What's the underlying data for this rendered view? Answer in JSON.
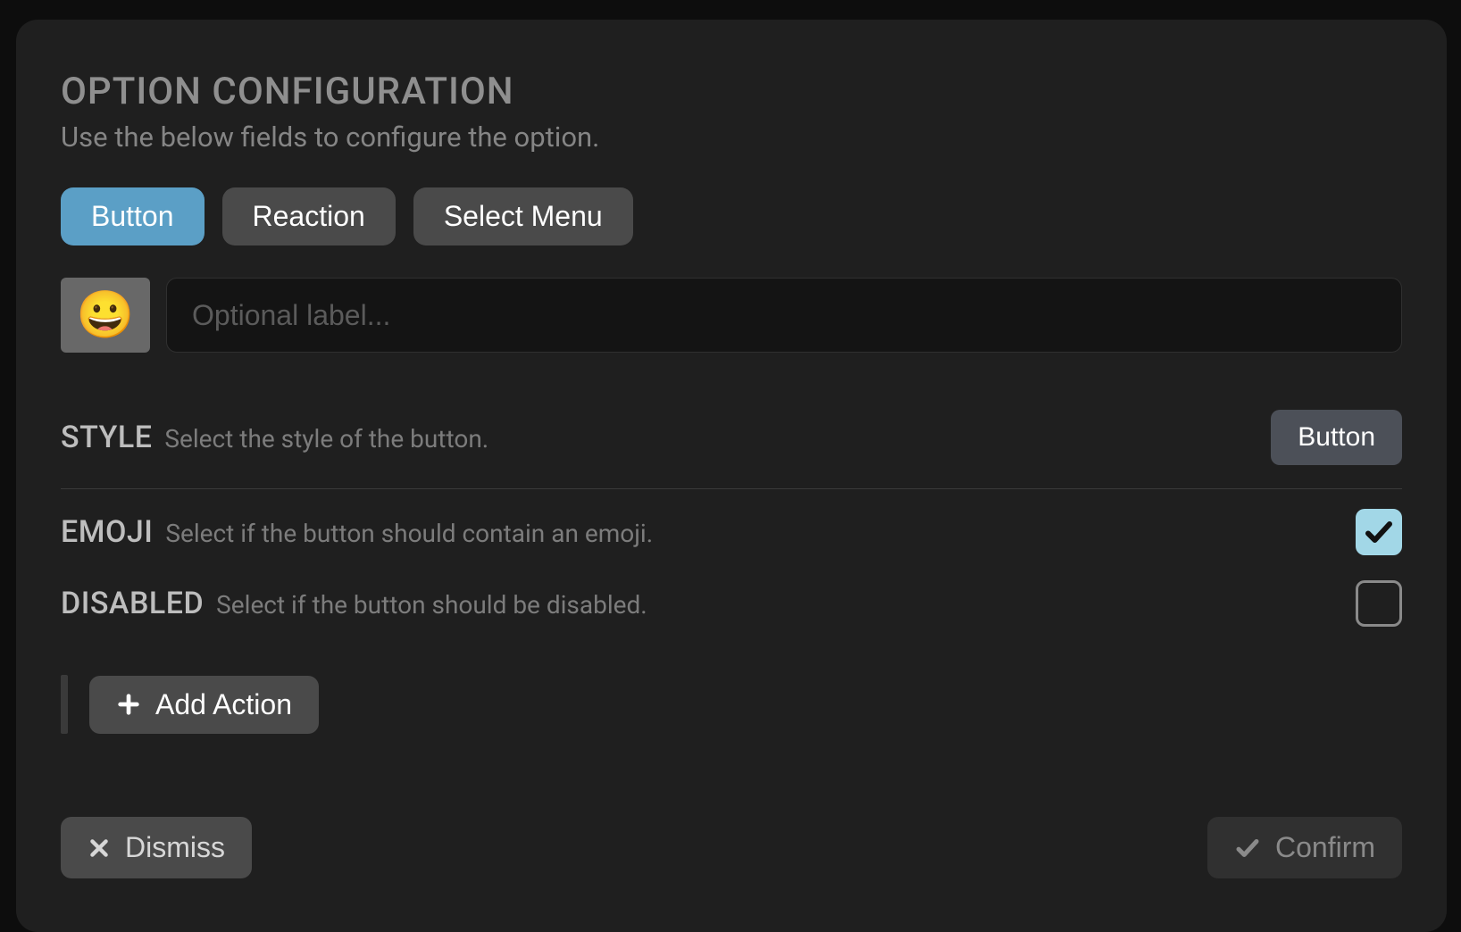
{
  "header": {
    "title": "OPTION CONFIGURATION",
    "subtitle": "Use the below fields to configure the option."
  },
  "tabs": {
    "button": "Button",
    "reaction": "Reaction",
    "select_menu": "Select Menu"
  },
  "label_row": {
    "emoji_icon": "grinning-face-emoji",
    "placeholder": "Optional label..."
  },
  "style": {
    "title": "STYLE",
    "description": "Select the style of the button.",
    "value": "Button"
  },
  "emoji": {
    "title": "EMOJI",
    "description": "Select if the button should contain an emoji.",
    "checked": true
  },
  "disabled": {
    "title": "DISABLED",
    "description": "Select if the button should be disabled.",
    "checked": false
  },
  "add_action": {
    "label": "Add Action"
  },
  "footer": {
    "dismiss": "Dismiss",
    "confirm": "Confirm"
  }
}
